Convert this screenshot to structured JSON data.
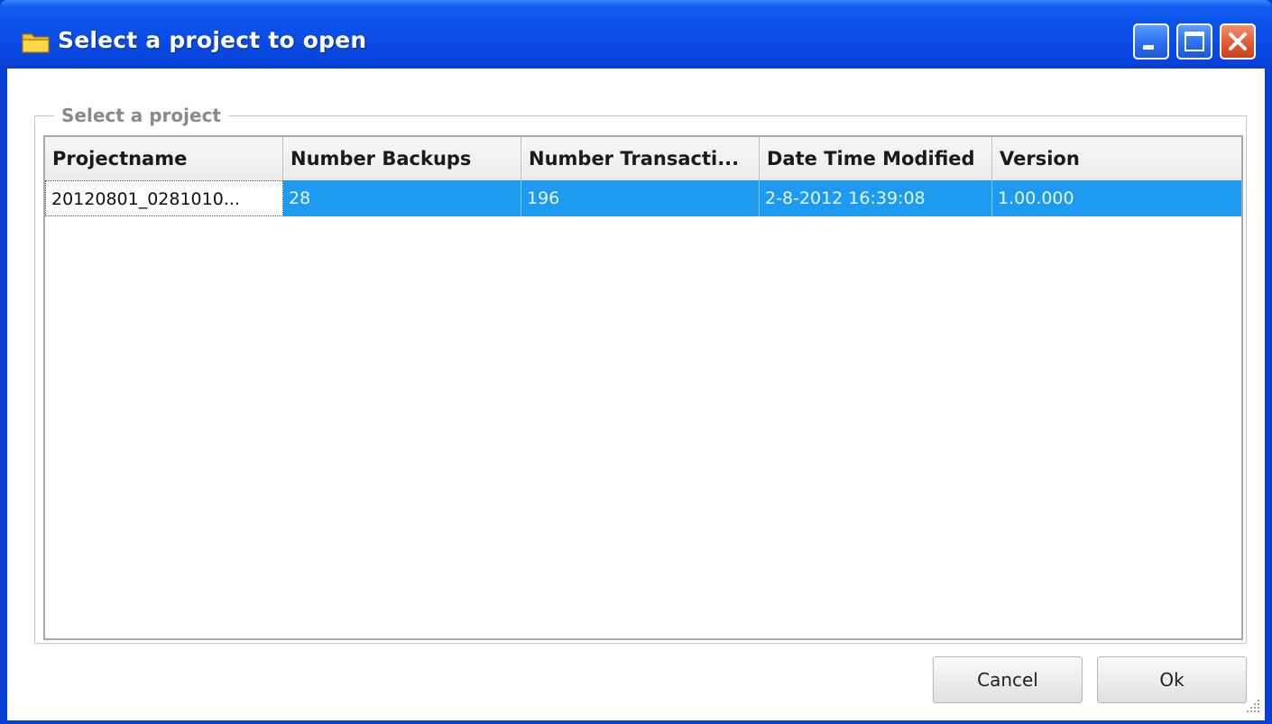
{
  "window": {
    "title": "Select a project to open"
  },
  "groupbox": {
    "legend": "Select a project"
  },
  "table": {
    "columns": [
      "Projectname",
      "Number Backups",
      "Number Transacti...",
      "Date Time Modified",
      "Version"
    ],
    "rows": [
      [
        "20120801_0281010...",
        "28",
        "196",
        "2-8-2012 16:39:08",
        "1.00.000"
      ]
    ]
  },
  "buttons": {
    "cancel": "Cancel",
    "ok": "Ok"
  },
  "colors": {
    "titlebar": "#0a4ee6",
    "selection": "#1c9bf0",
    "close_button": "#e05a32"
  },
  "icons": {
    "title": "folder-icon",
    "minimize": "minimize-icon",
    "maximize": "maximize-icon",
    "close": "close-icon"
  }
}
